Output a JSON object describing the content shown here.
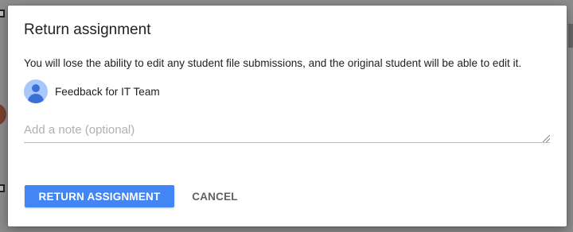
{
  "dialog": {
    "title": "Return assignment",
    "message": "You will lose the ability to edit any student file submissions, and the original student will be able to edit it.",
    "recipient": {
      "name": "Feedback for IT Team",
      "icon": "person-avatar-icon"
    },
    "note": {
      "value": "",
      "placeholder": "Add a note (optional)"
    },
    "buttons": {
      "primary_label": "RETURN ASSIGNMENT",
      "cancel_label": "CANCEL"
    }
  },
  "colors": {
    "primary": "#4285f4",
    "avatar_bg": "#a8c7fa",
    "avatar_fg": "#3b6fd8",
    "overlay": "#8c8c8c"
  }
}
